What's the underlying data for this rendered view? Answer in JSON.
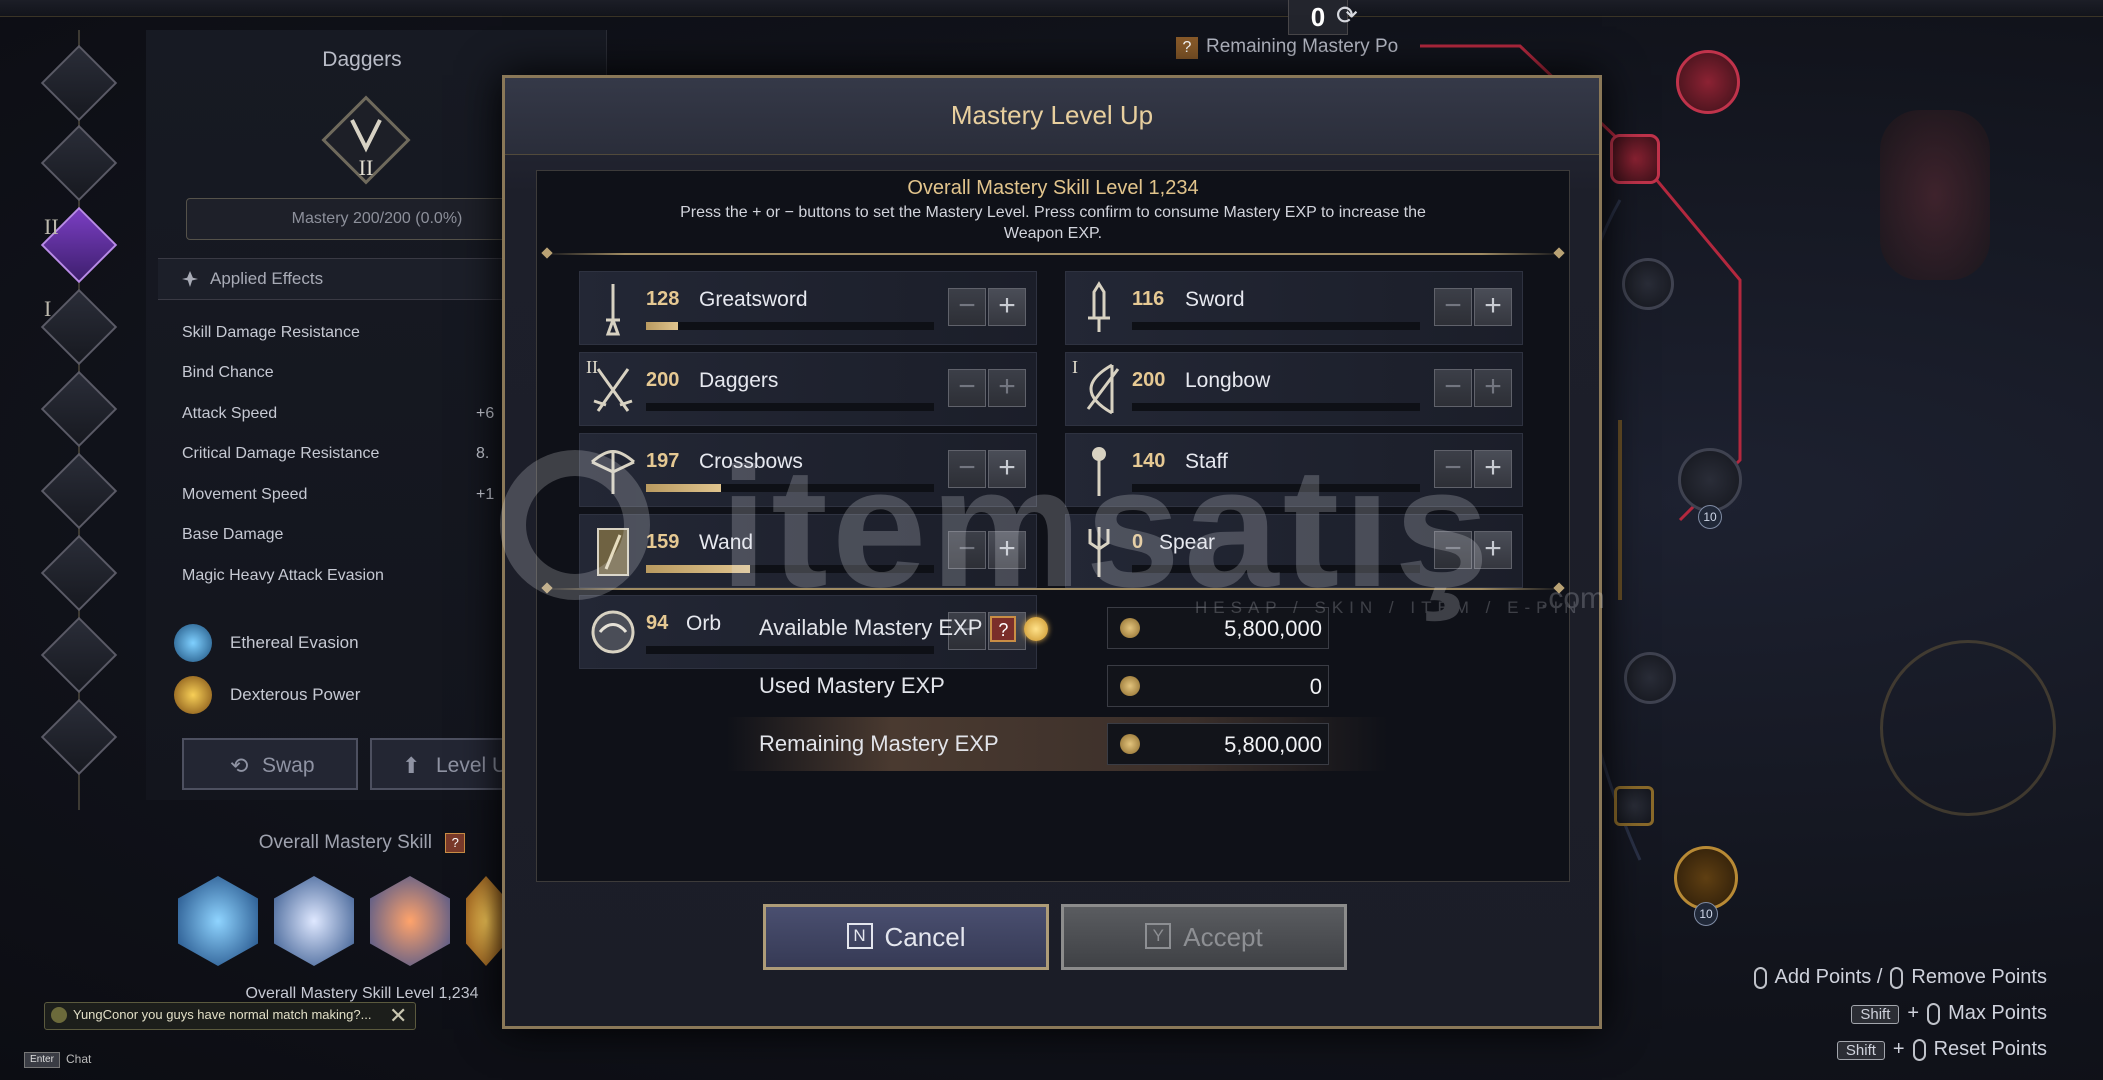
{
  "scene": {
    "top_counter": "0",
    "remaining_points_label": "Remaining Mastery Po",
    "node_level_1": "10",
    "node_level_2": "10",
    "hints": {
      "add_points": "Add Points /",
      "remove_points": "Remove Points",
      "shift_key": "Shift",
      "plus": "+",
      "max_points": "Max Points",
      "reset_points": "Reset Points"
    }
  },
  "rail": {
    "roman_2": "II",
    "roman_1": "I"
  },
  "left_panel": {
    "title": "Daggers",
    "emblem_roman": "II",
    "mastery_text": "Mastery 200/200 (0.0%)",
    "applied_effects_label": "Applied Effects",
    "stats": [
      {
        "name": "Skill Damage Resistance",
        "value": ""
      },
      {
        "name": "Bind Chance",
        "value": ""
      },
      {
        "name": "Attack Speed",
        "value": "+6"
      },
      {
        "name": "Critical Damage Resistance",
        "value": "8."
      },
      {
        "name": "Movement Speed",
        "value": "+1"
      },
      {
        "name": "Base Damage",
        "value": ""
      },
      {
        "name": "Magic Heavy Attack Evasion",
        "value": ""
      }
    ],
    "abilities": [
      {
        "name": "Ethereal Evasion"
      },
      {
        "name": "Dexterous Power"
      }
    ],
    "swap_label": "Swap",
    "level_up_label": "Level U",
    "overall_mastery_skill_label": "Overall Mastery Skill",
    "overall_level_text": "Overall Mastery Skill Level 1,234"
  },
  "chat": {
    "message": "YungConor  you guys have normal match making?...",
    "close_glyph": "✕",
    "enter_key": "Enter",
    "chat_label": "Chat"
  },
  "watermark": {
    "brand": "itemsatış",
    "tagline": "HESAP / SKIN / ITEM / E-PIN",
    "suffix": ".com"
  },
  "dialog": {
    "title": "Mastery Level Up",
    "overall_title": "Overall Mastery Skill Level 1,234",
    "description": "Press the + or − buttons to set the Mastery Level. Press confirm to consume Mastery EXP to increase the Weapon EXP.",
    "minus_glyph": "−",
    "plus_glyph": "+",
    "weapons": [
      {
        "level": "128",
        "name": "Greatsword",
        "progress": 0.11,
        "icon": "greatsword-icon",
        "roman": ""
      },
      {
        "level": "116",
        "name": "Sword",
        "progress": 0.0,
        "icon": "sword-icon",
        "roman": ""
      },
      {
        "level": "200",
        "name": "Daggers",
        "progress": 0.0,
        "icon": "daggers-icon",
        "roman": "II"
      },
      {
        "level": "200",
        "name": "Longbow",
        "progress": 0.0,
        "icon": "longbow-icon",
        "roman": "I"
      },
      {
        "level": "197",
        "name": "Crossbows",
        "progress": 0.26,
        "icon": "crossbow-icon",
        "roman": ""
      },
      {
        "level": "140",
        "name": "Staff",
        "progress": 0.0,
        "icon": "staff-icon",
        "roman": ""
      },
      {
        "level": "159",
        "name": "Wand",
        "progress": 0.36,
        "icon": "wand-icon",
        "roman": ""
      },
      {
        "level": "0",
        "name": "Spear",
        "progress": 0.0,
        "icon": "spear-icon",
        "roman": ""
      },
      {
        "level": "94",
        "name": "Orb",
        "progress": 0.0,
        "icon": "orb-icon",
        "roman": ""
      }
    ],
    "exp": {
      "available_label": "Available Mastery EXP",
      "available_value": "5,800,000",
      "used_label": "Used Mastery EXP",
      "used_value": "0",
      "remaining_label": "Remaining Mastery EXP",
      "remaining_value": "5,800,000",
      "help_glyph": "?"
    },
    "cancel_key": "N",
    "cancel_label": "Cancel",
    "accept_key": "Y",
    "accept_label": "Accept"
  },
  "colors": {
    "accent_gold": "#e8cf9e",
    "progress_fill": "#e0c48e",
    "cancel_bg": "#4a4f70",
    "accept_bg": "#5a5c60",
    "node_red": "#c0334b",
    "rail_active": "#7a3ec2"
  }
}
